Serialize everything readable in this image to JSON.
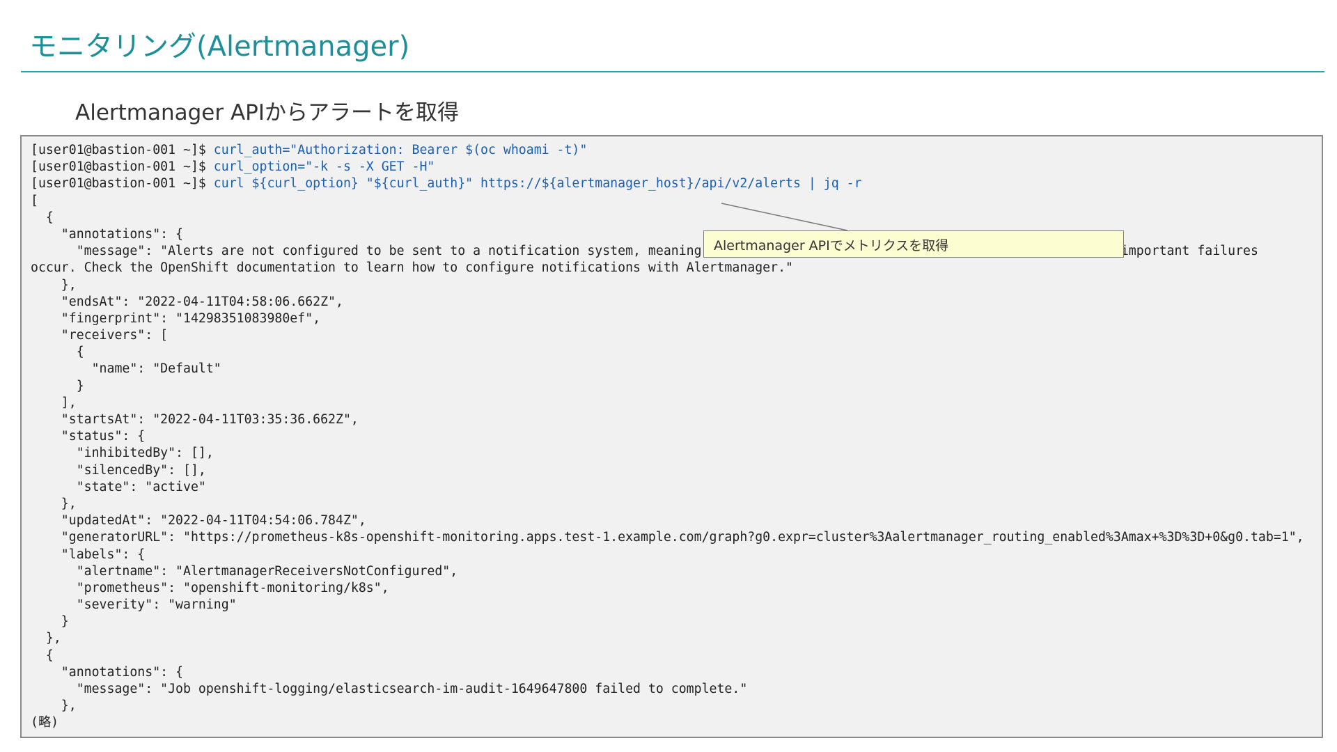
{
  "slide": {
    "title": "モニタリング(Alertmanager)",
    "subtitle": "Alertmanager APIからアラートを取得"
  },
  "terminal": {
    "lines": [
      {
        "prompt": "[user01@bastion-001 ~]$ ",
        "command": "curl_auth=\"Authorization: Bearer $(oc whoami -t)\""
      },
      {
        "prompt": "[user01@bastion-001 ~]$ ",
        "command": "curl_option=\"-k -s -X GET -H\""
      },
      {
        "prompt": "[user01@bastion-001 ~]$ ",
        "command": "curl ${curl_option} \"${curl_auth}\" https://${alertmanager_host}/api/v2/alerts | jq -r"
      },
      {
        "prompt": "[",
        "command": ""
      },
      {
        "prompt": "  {",
        "command": ""
      },
      {
        "prompt": "    \"annotations\": {",
        "command": ""
      },
      {
        "prompt": "      \"message\": \"Alerts are not configured to be sent to a notification system, meaning that you may not be notified in a timely fashion when important failures",
        "command": ""
      },
      {
        "prompt": "occur. Check the OpenShift documentation to learn how to configure notifications with Alertmanager.\"",
        "command": ""
      },
      {
        "prompt": "    },",
        "command": ""
      },
      {
        "prompt": "    \"endsAt\": \"2022-04-11T04:58:06.662Z\",",
        "command": ""
      },
      {
        "prompt": "    \"fingerprint\": \"14298351083980ef\",",
        "command": ""
      },
      {
        "prompt": "    \"receivers\": [",
        "command": ""
      },
      {
        "prompt": "      {",
        "command": ""
      },
      {
        "prompt": "        \"name\": \"Default\"",
        "command": ""
      },
      {
        "prompt": "      }",
        "command": ""
      },
      {
        "prompt": "    ],",
        "command": ""
      },
      {
        "prompt": "    \"startsAt\": \"2022-04-11T03:35:36.662Z\",",
        "command": ""
      },
      {
        "prompt": "    \"status\": {",
        "command": ""
      },
      {
        "prompt": "      \"inhibitedBy\": [],",
        "command": ""
      },
      {
        "prompt": "      \"silencedBy\": [],",
        "command": ""
      },
      {
        "prompt": "      \"state\": \"active\"",
        "command": ""
      },
      {
        "prompt": "    },",
        "command": ""
      },
      {
        "prompt": "    \"updatedAt\": \"2022-04-11T04:54:06.784Z\",",
        "command": ""
      },
      {
        "prompt": "    \"generatorURL\": \"https://prometheus-k8s-openshift-monitoring.apps.test-1.example.com/graph?g0.expr=cluster%3Aalertmanager_routing_enabled%3Amax+%3D%3D+0&g0.tab=1\",",
        "command": ""
      },
      {
        "prompt": "    \"labels\": {",
        "command": ""
      },
      {
        "prompt": "      \"alertname\": \"AlertmanagerReceiversNotConfigured\",",
        "command": ""
      },
      {
        "prompt": "      \"prometheus\": \"openshift-monitoring/k8s\",",
        "command": ""
      },
      {
        "prompt": "      \"severity\": \"warning\"",
        "command": ""
      },
      {
        "prompt": "    }",
        "command": ""
      },
      {
        "prompt": "  },",
        "command": ""
      },
      {
        "prompt": "  {",
        "command": ""
      },
      {
        "prompt": "    \"annotations\": {",
        "command": ""
      },
      {
        "prompt": "      \"message\": \"Job openshift-logging/elasticsearch-im-audit-1649647800 failed to complete.\"",
        "command": ""
      },
      {
        "prompt": "    },",
        "command": ""
      },
      {
        "prompt": "(略)",
        "command": ""
      }
    ]
  },
  "callout": {
    "text": "Alertmanager APIでメトリクスを取得"
  },
  "colors": {
    "title": "#1b8f9a",
    "rule": "#27a3ad",
    "command": "#1a5fb4",
    "callout_bg": "#fdfdd2",
    "terminal_bg": "#f1f1f1"
  }
}
